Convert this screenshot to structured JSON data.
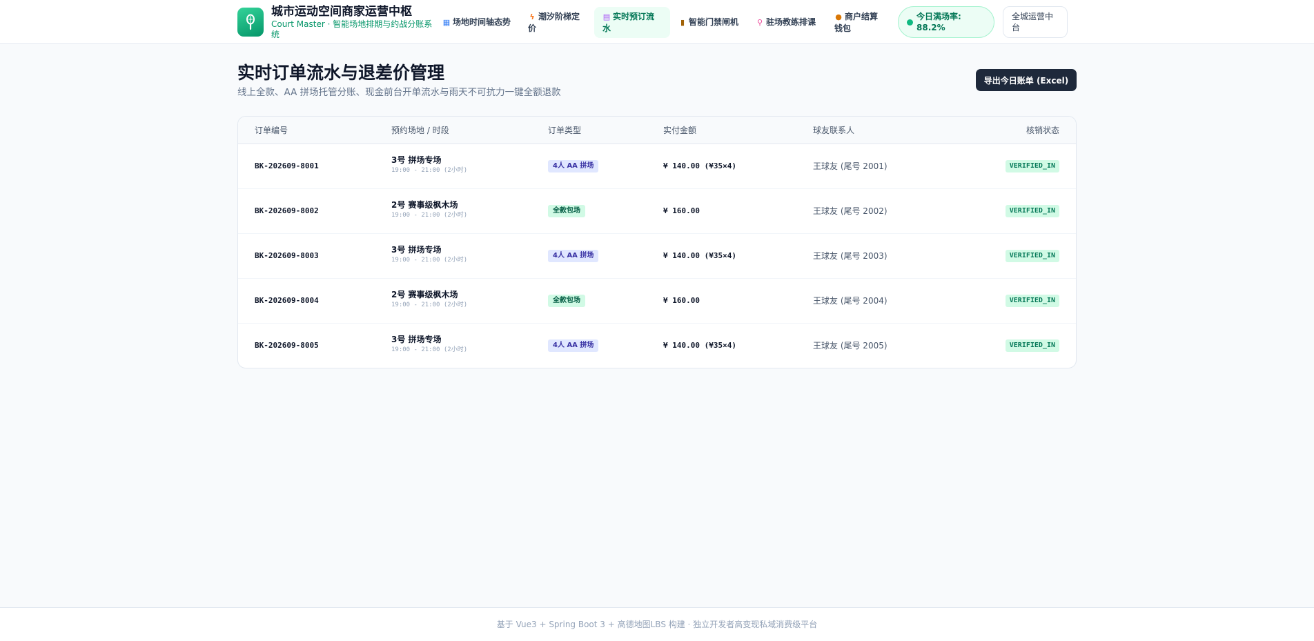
{
  "header": {
    "title": "城市运动空间商家运营中枢",
    "subtitle": "Court Master · 智能场地排期与约战分账系统",
    "nav": [
      {
        "icon": "calendar-icon",
        "label": "场地时间轴态势"
      },
      {
        "icon": "lightning-icon",
        "label": "潮汐阶梯定价"
      },
      {
        "icon": "clipboard-icon",
        "label": "实时预订流水",
        "active": true
      },
      {
        "icon": "door-icon",
        "label": "智能门禁闸机"
      },
      {
        "icon": "pin-icon",
        "label": "驻场教练排课"
      },
      {
        "icon": "moneybag-icon",
        "label": "商户结算钱包"
      }
    ],
    "rate_label": "今日满场率: 88.2%",
    "ops_label": "全城运营中台"
  },
  "page": {
    "title": "实时订单流水与退差价管理",
    "subtitle": "线上全款、AA 拼场托管分账、现金前台开单流水与雨天不可抗力一键全额退款",
    "export_label": "导出今日账单 (Excel)"
  },
  "table": {
    "columns": [
      "订单编号",
      "预约场地 / 时段",
      "订单类型",
      "实付金额",
      "球友联系人",
      "核销状态"
    ],
    "rows": [
      {
        "id": "BK-202609-8001",
        "court": "3号 拼场专场",
        "time": "19:00 - 21:00 (2小时)",
        "type": "4人 AA 拼场",
        "type_kind": "aa",
        "amount": "¥ 140.00 (¥35×4)",
        "contact": "王球友 (尾号 2001)",
        "status": "VERIFIED_IN"
      },
      {
        "id": "BK-202609-8002",
        "court": "2号 赛事级枫木场",
        "time": "19:00 - 21:00 (2小时)",
        "type": "全款包场",
        "type_kind": "full",
        "amount": "¥ 160.00",
        "contact": "王球友 (尾号 2002)",
        "status": "VERIFIED_IN"
      },
      {
        "id": "BK-202609-8003",
        "court": "3号 拼场专场",
        "time": "19:00 - 21:00 (2小时)",
        "type": "4人 AA 拼场",
        "type_kind": "aa",
        "amount": "¥ 140.00 (¥35×4)",
        "contact": "王球友 (尾号 2003)",
        "status": "VERIFIED_IN"
      },
      {
        "id": "BK-202609-8004",
        "court": "2号 赛事级枫木场",
        "time": "19:00 - 21:00 (2小时)",
        "type": "全款包场",
        "type_kind": "full",
        "amount": "¥ 160.00",
        "contact": "王球友 (尾号 2004)",
        "status": "VERIFIED_IN"
      },
      {
        "id": "BK-202609-8005",
        "court": "3号 拼场专场",
        "time": "19:00 - 21:00 (2小时)",
        "type": "4人 AA 拼场",
        "type_kind": "aa",
        "amount": "¥ 140.00 (¥35×4)",
        "contact": "王球友 (尾号 2005)",
        "status": "VERIFIED_IN"
      }
    ]
  },
  "footer": {
    "text": "基于 Vue3 + Spring Boot 3 + 高德地图LBS 构建 · 独立开发者高变现私域消费级平台"
  },
  "colors": {
    "accent": "#059669",
    "active_bg": "#ecfdf5",
    "dark_button": "#1e293b",
    "status_bg": "#d1fae5",
    "aa_bg": "#e0e7ff"
  }
}
